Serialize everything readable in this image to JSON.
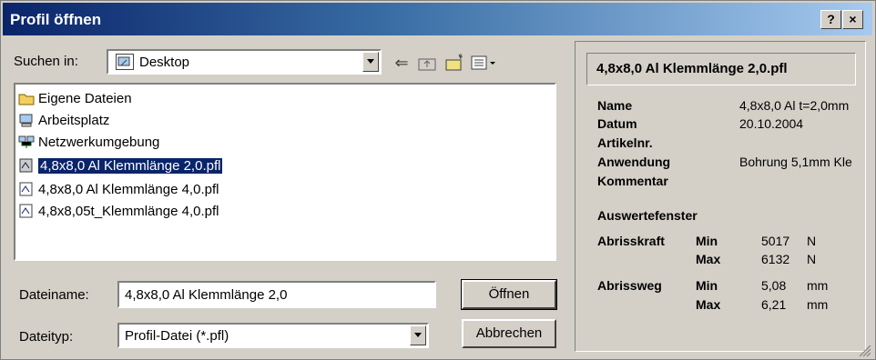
{
  "dialog": {
    "title": "Profil öffnen",
    "help_label": "?",
    "close_label": "×"
  },
  "lookin": {
    "label": "Suchen in:",
    "value": "Desktop"
  },
  "files": [
    {
      "name": "Eigene Dateien",
      "icon": "folder-icon"
    },
    {
      "name": "Arbeitsplatz",
      "icon": "computer-icon"
    },
    {
      "name": "Netzwerkumgebung",
      "icon": "network-icon"
    },
    {
      "name": "4,8x8,0 Al Klemmlänge 2,0.pfl",
      "icon": "profile-file-icon",
      "selected": true
    },
    {
      "name": "4,8x8,0 Al Klemmlänge 4,0.pfl",
      "icon": "profile-file-icon"
    },
    {
      "name": "4,8x8,05t_Klemmlänge 4,0.pfl",
      "icon": "profile-file-icon"
    }
  ],
  "filename": {
    "label": "Dateiname:",
    "value": "4,8x8,0 Al Klemmlänge 2,0"
  },
  "filetype": {
    "label": "Dateityp:",
    "value": "Profil-Datei (*.pfl)"
  },
  "buttons": {
    "open": "Öffnen",
    "cancel": "Abbrechen"
  },
  "preview": {
    "title": "4,8x8,0 Al Klemmlänge 2,0.pfl",
    "name_label": "Name",
    "name_value": "4,8x8,0 Al t=2,0mm",
    "date_label": "Datum",
    "date_value": "20.10.2004",
    "article_label": "Artikelnr.",
    "usage_label": "Anwendung",
    "usage_value": "Bohrung 5,1mm Kle",
    "comment_label": "Kommentar",
    "eval_label": "Auswertefenster",
    "force_label": "Abrisskraft",
    "force_min_label": "Min",
    "force_min": "5017",
    "force_min_unit": "N",
    "force_max_label": "Max",
    "force_max": "6132",
    "force_max_unit": "N",
    "travel_label": "Abrissweg",
    "travel_min_label": "Min",
    "travel_min": "5,08",
    "travel_min_unit": "mm",
    "travel_max_label": "Max",
    "travel_max": "6,21",
    "travel_max_unit": "mm"
  }
}
